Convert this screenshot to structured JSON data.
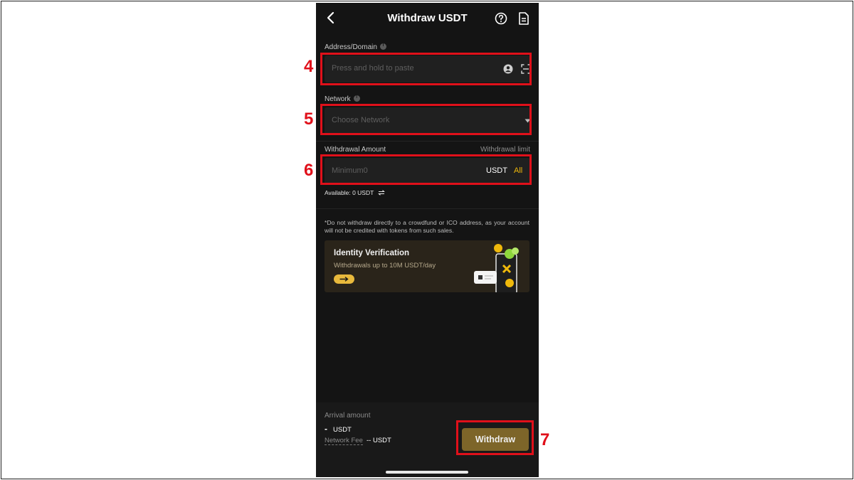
{
  "header": {
    "title": "Withdraw USDT"
  },
  "address": {
    "label": "Address/Domain",
    "placeholder": "Press and hold to paste"
  },
  "network": {
    "label": "Network",
    "placeholder": "Choose Network"
  },
  "amount": {
    "label": "Withdrawal Amount",
    "limit_link": "Withdrawal limit",
    "placeholder": "Minimum0",
    "currency": "USDT",
    "all_label": "All",
    "available": "Available: 0 USDT"
  },
  "notice": "*Do not withdraw directly to a crowdfund or ICO address, as your account will not be credited with tokens from such sales.",
  "promo": {
    "title": "Identity Verification",
    "subtitle": "Withdrawals up to 10M USDT/day"
  },
  "footer": {
    "arrival_label": "Arrival amount",
    "arrival_value": "-",
    "arrival_unit": "USDT",
    "fee_label": "Network Fee",
    "fee_value": "-- USDT",
    "withdraw_label": "Withdraw"
  },
  "annotations": {
    "address_step": "4",
    "network_step": "5",
    "amount_step": "6",
    "withdraw_step": "7"
  },
  "colors": {
    "accent": "#e8b93c",
    "button": "#7d6529",
    "highlight": "#e0101a",
    "background": "#141414"
  },
  "icons": [
    "back-arrow-icon",
    "help-icon",
    "document-icon",
    "info-icon",
    "contact-icon",
    "scan-icon",
    "dropdown-caret-icon",
    "swap-icon",
    "arrow-right-icon"
  ]
}
